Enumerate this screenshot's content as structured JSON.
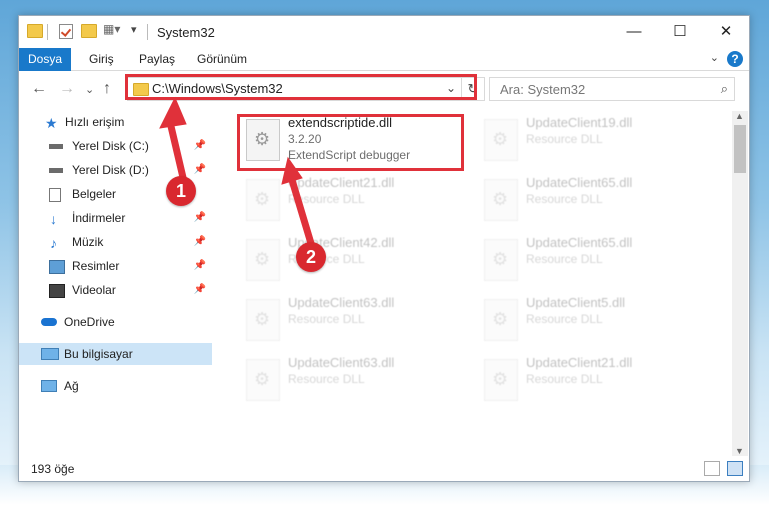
{
  "window": {
    "title": "System32",
    "controls": {
      "minimize": "—",
      "maximize": "☐",
      "close": "✕"
    }
  },
  "ribbon": {
    "tabs": [
      "Dosya",
      "Giriş",
      "Paylaş",
      "Görünüm"
    ],
    "expand_glyph": "⌄",
    "help": "?"
  },
  "navigation": {
    "back": "←",
    "forward": "→",
    "recent": "⌄",
    "up": "↑",
    "address": "C:\\Windows\\System32",
    "address_dropdown": "⌄",
    "refresh": "↻",
    "search_placeholder": "Ara: System32",
    "search_icon": "⌕"
  },
  "sidebar": {
    "items": [
      {
        "label": "Hızlı erişim",
        "icon": "star-icon"
      },
      {
        "label": "Yerel Disk (C:)",
        "icon": "drive-icon",
        "pinned": true
      },
      {
        "label": "Yerel Disk (D:)",
        "icon": "drive-icon",
        "pinned": true
      },
      {
        "label": "Belgeler",
        "icon": "documents-icon"
      },
      {
        "label": "İndirmeler",
        "icon": "download-icon",
        "pinned": true
      },
      {
        "label": "Müzik",
        "icon": "music-icon",
        "pinned": true
      },
      {
        "label": "Resimler",
        "icon": "pictures-icon",
        "pinned": true
      },
      {
        "label": "Videolar",
        "icon": "videos-icon",
        "pinned": true
      },
      {
        "label": "OneDrive",
        "icon": "cloud-icon"
      },
      {
        "label": "Bu bilgisayar",
        "icon": "computer-icon",
        "selected": true
      },
      {
        "label": "Ağ",
        "icon": "network-icon"
      }
    ],
    "pin_glyph": "📌"
  },
  "files": [
    {
      "name": "extendscriptide.dll",
      "line2": "3.2.20",
      "line3": "ExtendScript debugger",
      "faded": false
    },
    {
      "name": "UpdateClient19.dll",
      "line2": "Resource DLL",
      "faded": true
    },
    {
      "name": "UpdateClient21.dll",
      "line2": "Resource DLL",
      "faded": true
    },
    {
      "name": "UpdateClient65.dll",
      "line2": "Resource DLL",
      "faded": true
    },
    {
      "name": "UpdateClient42.dll",
      "line2": "Resource DLL",
      "faded": true
    },
    {
      "name": "UpdateClient65.dll",
      "line2": "Resource DLL",
      "faded": true
    },
    {
      "name": "UpdateClient63.dll",
      "line2": "Resource DLL",
      "faded": true
    },
    {
      "name": "UpdateClient5.dll",
      "line2": "Resource DLL",
      "faded": true
    },
    {
      "name": "UpdateClient63.dll",
      "line2": "Resource DLL",
      "faded": true
    },
    {
      "name": "UpdateClient21.dll",
      "line2": "Resource DLL",
      "faded": true
    }
  ],
  "status": {
    "count": "193 öğe"
  },
  "annotations": {
    "marker1": "1",
    "marker2": "2",
    "highlight_color": "#e0313a",
    "accent": "#1979ca"
  }
}
